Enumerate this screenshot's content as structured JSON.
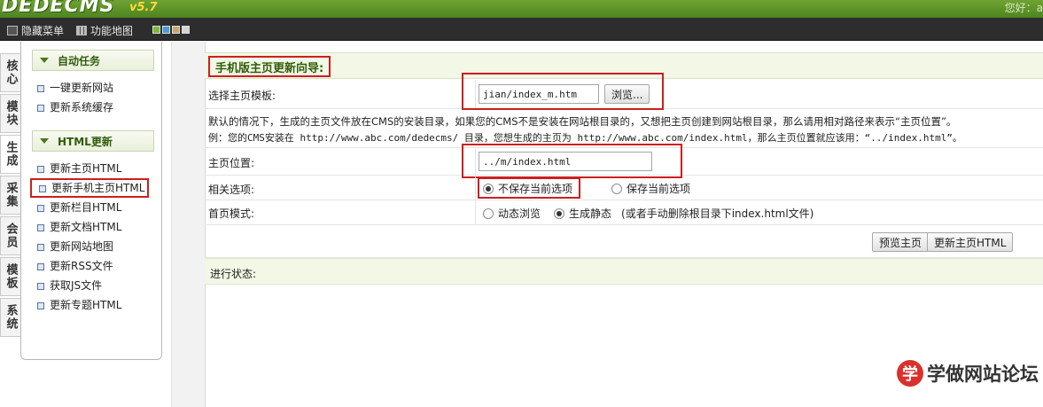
{
  "banner": {
    "logo": "DEDECMS",
    "version": "v5.7",
    "greeting": "您好：a"
  },
  "toolbar": {
    "hide_menu": "隐藏菜单",
    "sitemap": "功能地图",
    "skin_colors": [
      "#7fb83a",
      "#4d9ad3",
      "#c8a86a",
      "#d4d4d4"
    ]
  },
  "vtabs": [
    "核心",
    "模块",
    "生成",
    "采集",
    "会员",
    "模板",
    "系统"
  ],
  "sidebar": {
    "sections": [
      {
        "title": "自动任务",
        "items": [
          "一键更新网站",
          "更新系统缓存"
        ]
      },
      {
        "title": "HTML更新",
        "items": [
          "更新主页HTML",
          "更新手机主页HTML",
          "更新栏目HTML",
          "更新文档HTML",
          "更新网站地图",
          "更新RSS文件",
          "获取JS文件",
          "更新专题HTML"
        ]
      }
    ]
  },
  "form": {
    "title": "手机版主页更新向导:",
    "template_label": "选择主页模板:",
    "template_value": "jian/index_m.htm",
    "browse_label": "浏览...",
    "hint1": "默认的情况下，生成的主页文件放在CMS的安装目录，如果您的CMS不是安装在网站根目录的，又想把主页创建到网站根目录，那么请用相对路径来表示“主页位置”。",
    "hint2": "例：您的CMS安装在 http://www.abc.com/dedecms/ 目录，您想生成的主页为 http://www.abc.com/index.html，那么主页位置就应该用：“../index.html”。",
    "position_label": "主页位置:",
    "position_value": "../m/index.html",
    "options_label": "相关选项:",
    "option_nosave": "不保存当前选项",
    "option_save": "保存当前选项",
    "mode_label": "首页模式:",
    "mode_dynamic": "动态浏览",
    "mode_static": "生成静态",
    "mode_static_note": "(或者手动删除根目录下index.html文件)",
    "preview_label": "预览主页",
    "update_label": "更新主页HTML",
    "status_label": "进行状态:"
  },
  "watermark": {
    "icon_char": "学",
    "text": "学做网站论坛"
  }
}
